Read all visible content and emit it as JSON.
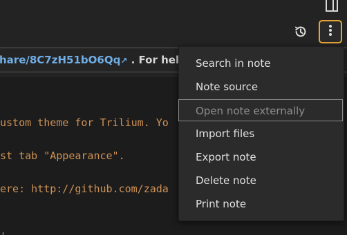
{
  "toolbar": {
    "history_icon": "history-icon",
    "more_icon": "vertical-ellipsis-icon",
    "panel_icon": "panel-toggle-icon",
    "accent_color": "#e8a63a"
  },
  "help_banner": {
    "link_text": "hare/8C7zH51bO6Qq",
    "link_arrow": "↗",
    "suffix_text": ". For help"
  },
  "code": {
    "lines": [
      "ustom theme for Trilium. Yo",
      "st tab \"Appearance\".",
      "ere: http://github.com/zada",
      "'"
    ],
    "text_color": "#ce9156"
  },
  "menu": {
    "items": [
      {
        "label": "Search in note",
        "enabled": true
      },
      {
        "label": "Note source",
        "enabled": true
      },
      {
        "label": "Open note externally",
        "enabled": false
      },
      {
        "label": "Import files",
        "enabled": true
      },
      {
        "label": "Export note",
        "enabled": true
      },
      {
        "label": "Delete note",
        "enabled": true
      },
      {
        "label": "Print note",
        "enabled": true
      }
    ]
  }
}
